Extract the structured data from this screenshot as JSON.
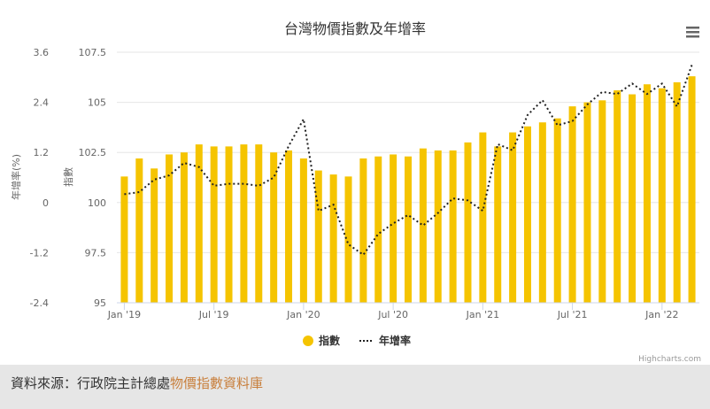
{
  "chart_data": {
    "type": "bar",
    "title": "台灣物價指數及年增率",
    "x_ticks": [
      "Jan '19",
      "Jul '19",
      "Jan '20",
      "Jul '20",
      "Jan '21",
      "Jul '21",
      "Jan '22"
    ],
    "y_left": {
      "label": "年增率(%)",
      "ticks": [
        "3.6",
        "2.4",
        "1.2",
        "0",
        "-1.2",
        "-2.4"
      ],
      "min": -2.4,
      "max": 3.6
    },
    "y_right": {
      "label": "指數",
      "ticks": [
        "107.5",
        "105",
        "102.5",
        "100",
        "97.5",
        "95"
      ],
      "min": 95,
      "max": 107.5
    },
    "grid": true,
    "legend_position": "bottom-center",
    "series": [
      {
        "name": "指數",
        "type": "bar",
        "axis": "指數",
        "color": "#f5c400",
        "values": [
          101.3,
          102.2,
          101.7,
          102.4,
          102.5,
          102.9,
          102.8,
          102.8,
          102.9,
          102.9,
          102.5,
          102.6,
          102.2,
          101.6,
          101.4,
          101.3,
          102.2,
          102.3,
          102.4,
          102.3,
          102.7,
          102.6,
          102.6,
          103.0,
          103.5,
          102.8,
          103.5,
          103.8,
          104.0,
          104.2,
          104.8,
          105.0,
          105.1,
          105.6,
          105.4,
          105.9,
          105.7,
          106.0,
          106.3
        ]
      },
      {
        "name": "年增率",
        "type": "line",
        "axis": "年增率(%)",
        "color": "#222222",
        "values": [
          0.2,
          0.25,
          0.55,
          0.65,
          0.95,
          0.85,
          0.4,
          0.45,
          0.45,
          0.4,
          0.6,
          1.35,
          2.0,
          -0.2,
          -0.05,
          -1.0,
          -1.25,
          -0.75,
          -0.5,
          -0.3,
          -0.55,
          -0.25,
          0.1,
          0.05,
          -0.2,
          1.4,
          1.25,
          2.1,
          2.45,
          1.85,
          1.95,
          2.35,
          2.65,
          2.6,
          2.85,
          2.6,
          2.85,
          2.3,
          3.3
        ]
      }
    ]
  },
  "menu_icon": "hamburger-menu-icon",
  "credits": "Highcharts.com",
  "footer": {
    "prefix": "資料來源：行政院主計總處",
    "link_text": "物價指數資料庫",
    "link_color": "#c87f3c"
  }
}
